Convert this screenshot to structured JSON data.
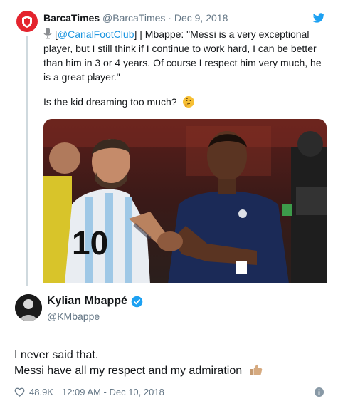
{
  "quoted_tweet": {
    "name": "BarcaTimes",
    "handle": "@BarcaTimes",
    "separator": "·",
    "date": "Dec 9, 2018",
    "text_open": "[",
    "mention": "@CanalFootClub",
    "text_rest": "] | Mbappe: \"Messi is a very exceptional player, but I still think if I continue to work hard, I can be better than him in 3 or 4 years. Of course I respect him very much, he is a great player.\"",
    "question": "Is the kid dreaming too much?",
    "icons": [
      "microphone-icon",
      "thinking-face-icon",
      "twitter-bird-icon"
    ]
  },
  "main_tweet": {
    "name": "Kylian Mbappé",
    "handle": "@KMbappe",
    "line1": "I never said that.",
    "line2": "Messi have all my respect and my admiration",
    "likes": "48.9K",
    "timestamp": "12:09 AM - Dec 10, 2018",
    "icons": [
      "verified-badge-icon",
      "thumbs-up-icon",
      "heart-icon",
      "info-icon"
    ]
  },
  "colors": {
    "link": "#1b95e0",
    "verified": "#1da1f2",
    "muted": "#657786",
    "avatar_red": "#e4242e"
  }
}
